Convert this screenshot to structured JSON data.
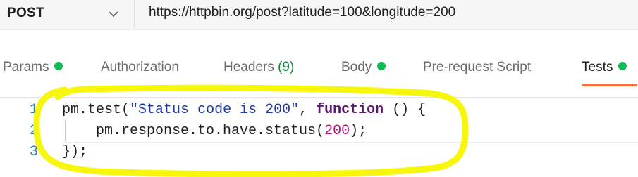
{
  "request": {
    "method": "POST",
    "url": "https://httpbin.org/post?latitude=100&longitude=200"
  },
  "tabs": [
    {
      "label": "Params",
      "has_dot": true
    },
    {
      "label": "Authorization"
    },
    {
      "label": "Headers",
      "count": "(9)"
    },
    {
      "label": "Body",
      "has_dot": true
    },
    {
      "label": "Pre-request Script"
    },
    {
      "label": "Tests",
      "has_dot": true,
      "active": true
    }
  ],
  "editor": {
    "line_numbers": [
      "1",
      "2",
      "3"
    ],
    "lines": [
      {
        "tokens": [
          {
            "t": "pm.",
            "c": "plain"
          },
          {
            "t": "test",
            "c": "fn"
          },
          {
            "t": "(",
            "c": "plain"
          },
          {
            "t": "\"Status code is 200\"",
            "c": "str"
          },
          {
            "t": ", ",
            "c": "plain"
          },
          {
            "t": "function",
            "c": "kw"
          },
          {
            "t": " () {",
            "c": "plain"
          }
        ]
      },
      {
        "tokens": [
          {
            "t": "    pm.response.to.have.status(",
            "c": "plain"
          },
          {
            "t": "200",
            "c": "num"
          },
          {
            "t": ");",
            "c": "plain"
          }
        ]
      },
      {
        "tokens": [
          {
            "t": "});",
            "c": "plain"
          }
        ]
      }
    ]
  },
  "colors": {
    "accent": "#ff6c37",
    "dot_green": "#0cbb52",
    "highlight": "#f7f500"
  },
  "icons": {
    "method_dropdown": "chevron-down-icon"
  }
}
